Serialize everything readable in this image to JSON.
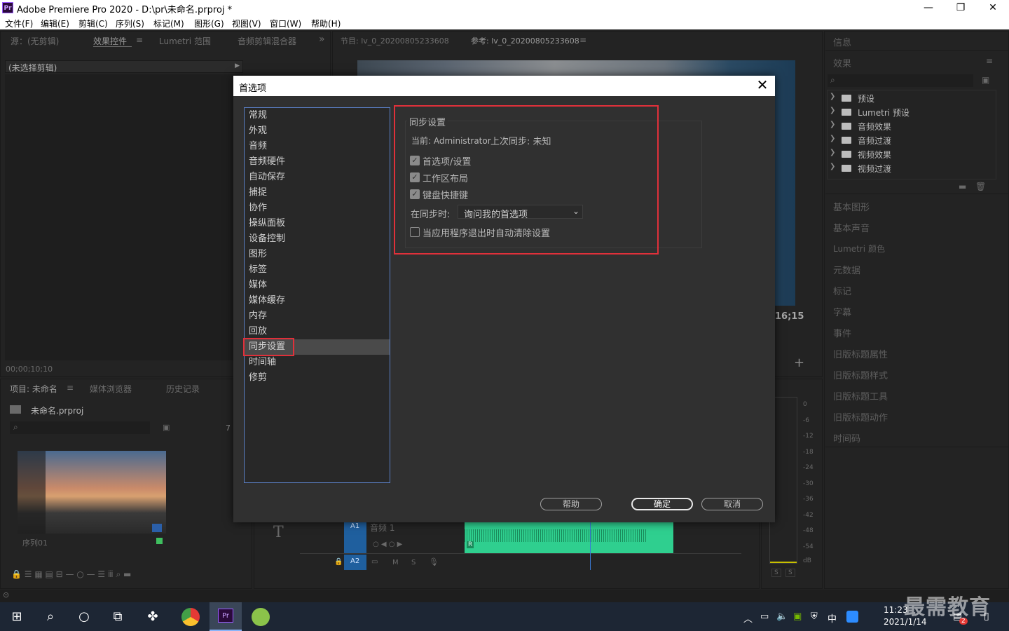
{
  "window": {
    "title": "Adobe Premiere Pro 2020 - D:\\pr\\未命名.prproj *",
    "icon_label": "Pr",
    "controls": [
      "—",
      "❐",
      "✕"
    ]
  },
  "menubar": [
    "文件(F)",
    "编辑(E)",
    "剪辑(C)",
    "序列(S)",
    "标记(M)",
    "图形(G)",
    "视图(V)",
    "窗口(W)",
    "帮助(H)"
  ],
  "source_panel": {
    "tabs": [
      "源：(无剪辑)",
      "效果控件",
      "Lumetri 范围",
      "音频剪辑混合器"
    ],
    "overflow": "»",
    "clip_bar": "(未选择剪辑)",
    "timecode": "00;00;10;10"
  },
  "program_panel": {
    "tabs": [
      "节目: lv_0_20200805233608",
      "参考: lv_0_20200805233608"
    ],
    "timecode_partial": "16;15",
    "add_button": "+"
  },
  "project_panel": {
    "tabs": [
      "项目: 未命名",
      "媒体浏览器",
      "历史记录"
    ],
    "project_file": "未命名.prproj",
    "item_count_partial": "7",
    "thumb_label": "序列01"
  },
  "timeline": {
    "tracks": [
      {
        "id": "A1",
        "name": "音频 1"
      },
      {
        "id": "A2",
        "name": ""
      }
    ],
    "track_buttons": [
      "M",
      "S"
    ],
    "title_tool": "T",
    "keyframe_label": "R"
  },
  "audio_meter": {
    "scale": [
      "0",
      "-6",
      "-12",
      "-18",
      "-24",
      "-30",
      "-36",
      "-42",
      "-48",
      "-54",
      "dB"
    ],
    "solo": [
      "S",
      "S"
    ]
  },
  "right_panel": {
    "info_tab": "信息",
    "effects_tab": "效果",
    "effects_items": [
      "预设",
      "Lumetri 预设",
      "音频效果",
      "音频过渡",
      "视频效果",
      "视频过渡"
    ],
    "collapsed_panels": [
      "基本图形",
      "基本声音",
      "Lumetri 颜色",
      "元数据",
      "标记",
      "字幕",
      "事件",
      "旧版标题属性",
      "旧版标题样式",
      "旧版标题工具",
      "旧版标题动作",
      "时间码"
    ]
  },
  "dialog": {
    "title": "首选项",
    "close": "✕",
    "categories": [
      "常规",
      "外观",
      "音频",
      "音频硬件",
      "自动保存",
      "捕捉",
      "协作",
      "操纵面板",
      "设备控制",
      "图形",
      "标签",
      "媒体",
      "媒体缓存",
      "内存",
      "回放",
      "同步设置",
      "时间轴",
      "修剪"
    ],
    "selected_category": "同步设置",
    "sync": {
      "heading": "同步设置",
      "current_user": "当前: Administrator",
      "last_sync": "上次同步: 未知",
      "checkboxes": [
        {
          "label": "首选项/设置",
          "checked": true
        },
        {
          "label": "工作区布局",
          "checked": true
        },
        {
          "label": "键盘快捷键",
          "checked": true
        }
      ],
      "on_sync_label": "在同步时:",
      "on_sync_value": "询问我的首选项",
      "clear_on_exit": {
        "label": "当应用程序退出时自动清除设置",
        "checked": false
      }
    },
    "buttons": {
      "help": "帮助",
      "ok": "确定",
      "cancel": "取消"
    }
  },
  "taskbar": {
    "time": "11:23",
    "date": "2021/1/14",
    "ime": "中",
    "notif_count": "2",
    "watermark": "最需教育"
  },
  "colors": {
    "highlight_red": "#e0303a",
    "list_border": "#5a7fc4",
    "audio_clip": "#2fcf8f",
    "track_label": "#1f5f9e"
  }
}
